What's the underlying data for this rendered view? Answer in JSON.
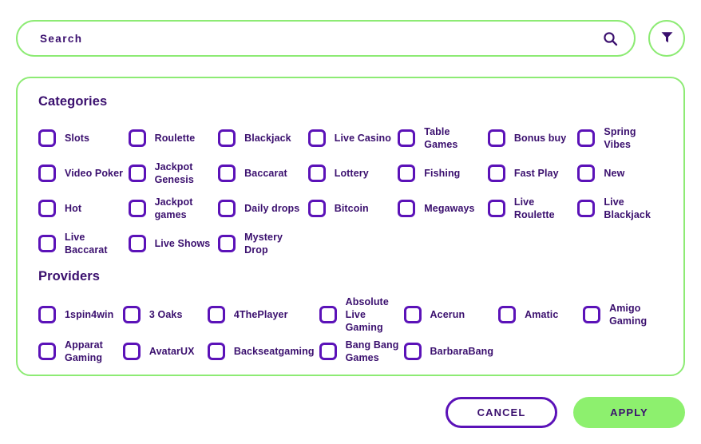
{
  "search": {
    "placeholder": "Search",
    "value": "",
    "search_icon": "search-icon",
    "filter_icon": "filter-funnel-icon"
  },
  "panel": {
    "categories": {
      "title": "Categories",
      "items": [
        "Slots",
        "Roulette",
        "Blackjack",
        "Live Casino",
        "Table Games",
        "Bonus buy",
        "Spring Vibes",
        "Video Poker",
        "Jackpot Genesis",
        "Baccarat",
        "Lottery",
        "Fishing",
        "Fast Play",
        "New",
        "Hot",
        "Jackpot games",
        "Daily drops",
        "Bitcoin",
        "Megaways",
        "Live Roulette",
        "Live Blackjack",
        "Live Baccarat",
        "Live Shows",
        "Mystery Drop"
      ]
    },
    "providers": {
      "title": "Providers",
      "items": [
        "1spin4win",
        "3 Oaks",
        "4ThePlayer",
        "Absolute Live Gaming",
        "Acerun",
        "Amatic",
        "Amigo Gaming",
        "Apparat Gaming",
        "AvatarUX",
        "Backseatgaming",
        "Bang Bang Games",
        "BarbaraBang"
      ]
    }
  },
  "footer": {
    "cancel_label": "CANCEL",
    "apply_label": "APPLY"
  },
  "colors": {
    "accent_green": "#8DEB74",
    "apply_green": "#8DF06E",
    "purple": "#5B12B8",
    "text_purple": "#3A0F6E"
  }
}
